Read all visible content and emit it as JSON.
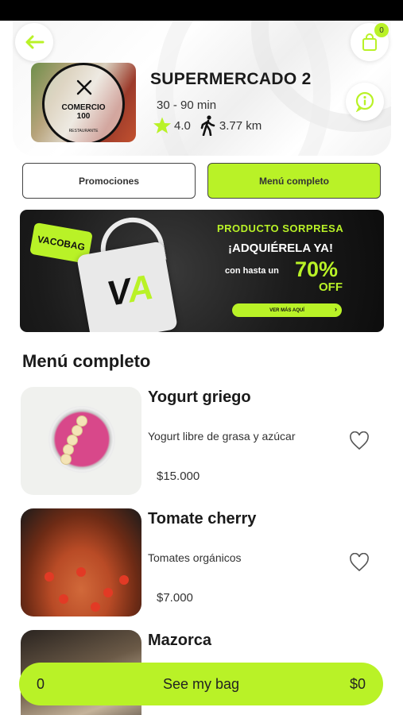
{
  "store": {
    "name": "SUPERMERCADO 2",
    "delivery_time": "30 - 90 min",
    "rating": "4.0",
    "distance": "3.77 km",
    "logo_text": "COMERCIO\n100",
    "logo_sub": "RESTAURANTE"
  },
  "header": {
    "cart_count": "0"
  },
  "tabs": [
    {
      "label": "Promociones",
      "active": false
    },
    {
      "label": "Menú completo",
      "active": true
    }
  ],
  "banner": {
    "tag": "VACOBAG",
    "title": "PRODUCTO SORPRESA",
    "subtitle": "¡ADQUIÉRELA YA!",
    "pre": "con hasta un",
    "percent": "70%",
    "off": "OFF",
    "cta": "VER MÁS AQUÍ",
    "bag_letters": "VA"
  },
  "section_title": "Menú completo",
  "products": [
    {
      "name": "Yogurt griego",
      "description": "Yogurt libre de grasa y azúcar",
      "price": "$15.000"
    },
    {
      "name": "Tomate cherry",
      "description": "Tomates orgánicos",
      "price": "$7.000"
    },
    {
      "name": "Mazorca",
      "description": "",
      "price": ""
    }
  ],
  "bag_bar": {
    "count": "0",
    "label": "See my bag",
    "total": "$0"
  },
  "colors": {
    "accent": "#b9f227",
    "dark": "#111111"
  },
  "icons": {
    "back": "arrow-left-icon",
    "bag": "shopping-bag-icon",
    "info": "info-icon",
    "star": "star-icon",
    "walk": "walking-person-icon",
    "heart": "heart-outline-icon"
  }
}
